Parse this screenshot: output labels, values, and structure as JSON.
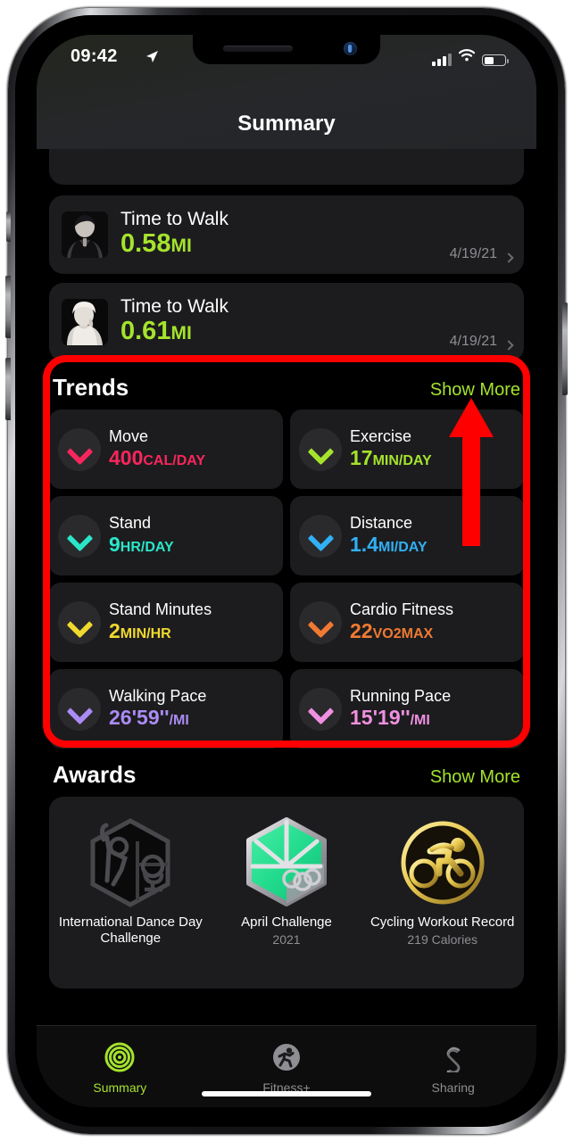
{
  "status_bar": {
    "time": "09:42",
    "location_icon": "location-arrow-icon",
    "signal_icon": "cellular-signal-icon",
    "wifi_icon": "wifi-icon",
    "battery_icon": "battery-icon",
    "battery_level_pct": 46
  },
  "nav": {
    "title": "Summary"
  },
  "walks": [
    {
      "title": "Time to Walk",
      "value": "0.58",
      "unit": "MI",
      "date": "4/19/21",
      "chevron": "chevron-right-icon"
    },
    {
      "title": "Time to Walk",
      "value": "0.61",
      "unit": "MI",
      "date": "4/19/21",
      "chevron": "chevron-right-icon"
    }
  ],
  "trends": {
    "title": "Trends",
    "show_more": "Show More",
    "cards": [
      {
        "name": "Move",
        "value": "400",
        "unit": "CAL/DAY",
        "color": "#f8265c",
        "arrow": "chevron-down-icon"
      },
      {
        "name": "Exercise",
        "value": "17",
        "unit": "MIN/DAY",
        "color": "#a5e32d",
        "arrow": "chevron-down-icon"
      },
      {
        "name": "Stand",
        "value": "9",
        "unit": "HR/DAY",
        "color": "#2ae6c8",
        "arrow": "chevron-down-icon"
      },
      {
        "name": "Distance",
        "value": "1.4",
        "unit": "MI/DAY",
        "color": "#31b0f5",
        "arrow": "chevron-down-icon"
      },
      {
        "name": "Stand Minutes",
        "value": "2",
        "unit": "MIN/HR",
        "color": "#f0d92e",
        "arrow": "chevron-down-icon"
      },
      {
        "name": "Cardio Fitness",
        "value": "22",
        "unit": "VO2MAX",
        "color": "#f07a32",
        "arrow": "chevron-down-icon"
      },
      {
        "name": "Walking Pace",
        "value": "26'59''",
        "unit": "/MI",
        "color": "#ab8bf5",
        "arrow": "chevron-down-icon"
      },
      {
        "name": "Running Pace",
        "value": "15'19''",
        "unit": "/MI",
        "color": "#f090e0",
        "arrow": "chevron-down-icon"
      }
    ]
  },
  "awards": {
    "title": "Awards",
    "show_more": "Show More",
    "items": [
      {
        "name": "International Dance Day Challenge",
        "sub": "",
        "badge": "dance-challenge-badge"
      },
      {
        "name": "April Challenge",
        "sub": "2021",
        "badge": "april-challenge-badge"
      },
      {
        "name": "Cycling Workout Record",
        "sub": "219 Calories",
        "badge": "cycling-record-badge"
      }
    ]
  },
  "tabs": [
    {
      "label": "Summary",
      "icon": "activity-rings-icon",
      "active": true
    },
    {
      "label": "Fitness+",
      "icon": "runner-icon",
      "active": false
    },
    {
      "label": "Sharing",
      "icon": "sharing-icon",
      "active": false
    }
  ],
  "annotation": {
    "highlight_color": "#ff0000",
    "arrow_icon": "up-arrow-annotation",
    "points_to": "Show More"
  }
}
